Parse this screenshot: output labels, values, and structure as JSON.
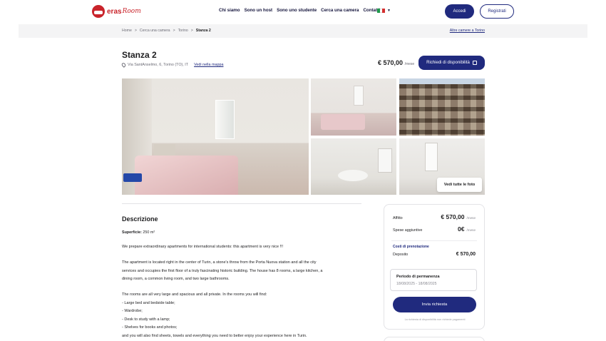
{
  "header": {
    "logo_text": "eras",
    "logo_script": "Room",
    "nav": [
      "Chi siamo",
      "Sono un host",
      "Sono uno studente",
      "Cerca una camera",
      "Contatti"
    ],
    "flag_colors": [
      "#1e9a4b",
      "#ffffff",
      "#d32f2f"
    ],
    "login_label": "Accedi",
    "register_label": "Registrati"
  },
  "breadcrumb": {
    "items": [
      "Home",
      ">",
      "Cerca una camera",
      ">",
      "Torino",
      ">"
    ],
    "current": "Stanza 2",
    "right_link": "Altre camere a Torino"
  },
  "listing": {
    "title": "Stanza 2",
    "address": "Via SantAnselmo, 6, Torino (TO), IT",
    "map_link": "Vedi nella mappa",
    "price": "€ 570,00",
    "price_unit": "/mese",
    "request_label": "Richiedi di disponibilità",
    "all_photos_label": "Vedi tutte le foto"
  },
  "description": {
    "heading": "Descrizione",
    "surface_label": "Superficie:",
    "surface_value": "250 m²",
    "lines": [
      "We prepare extraordinary apartments for international students: this apartment is very nice !!!",
      "",
      "The apartment is located right in the center of Turin, a stone's throw from the Porta Nuova station and all the city",
      "services and occupies the first floor of a truly fascinating historic building. The house has 8 rooms, a large kitchen, a",
      "dining room, a common living room, and two large bathrooms.",
      "",
      "The rooms are all very large and spacious and all private. In the rooms you will find:",
      "- Large bed and bedside table;",
      "- Wardrobe;",
      "- Desk to study with a lamp;",
      "- Shelves for books and photos;",
      "and you will also find sheets, towels and everything you need to better enjoy your experience here in Turin."
    ]
  },
  "booking": {
    "rent_label": "Affitto",
    "rent_value": "€ 570,00",
    "rent_unit": "/mese",
    "extra_label": "Spese aggiuntive",
    "extra_value": "0€",
    "extra_unit": "/mese",
    "costs_label": "Costi di prenotazione",
    "deposit_label": "Deposito",
    "deposit_value": "€ 570,00",
    "period_label": "Periodo di permanenza",
    "period_dates": "18/08/2025 - 18/08/2025",
    "send_label": "Invia richiesta",
    "note": "La richiesta di disponibilità non richiede pagamenti"
  }
}
